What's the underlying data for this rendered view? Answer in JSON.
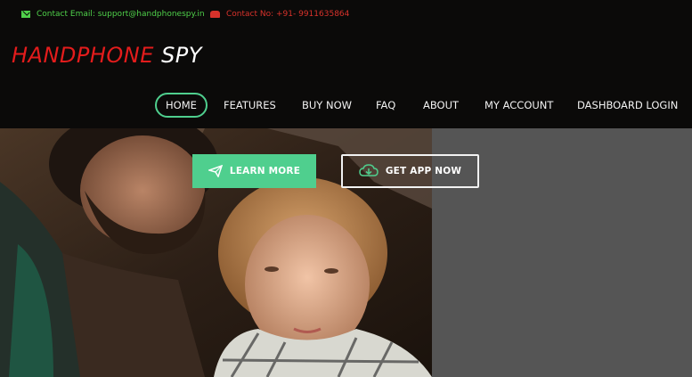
{
  "topbar": {
    "email_text": "Contact Email: support@handphonespy.in",
    "phone_text": "Contact No: +91- 9911635864",
    "email_icon": "mail-icon",
    "phone_icon": "phone-icon"
  },
  "brand": {
    "part1": "HANDPHONE",
    "part2": " SPY",
    "color_primary": "#e31c1c",
    "color_secondary": "#ffffff"
  },
  "nav": {
    "items": [
      {
        "label": "HOME",
        "active": true
      },
      {
        "label": "FEATURES"
      },
      {
        "label": "BUY NOW"
      },
      {
        "label": "FAQ"
      },
      {
        "label": "ABOUT"
      },
      {
        "label": "MY ACCOUNT"
      },
      {
        "label": "DASHBOARD LOGIN"
      }
    ],
    "accent": "#4fcf8e"
  },
  "hero": {
    "learn_more": "LEARN MORE",
    "get_app": "GET APP NOW",
    "learn_icon": "paper-plane-icon",
    "get_icon": "cloud-download-icon"
  }
}
